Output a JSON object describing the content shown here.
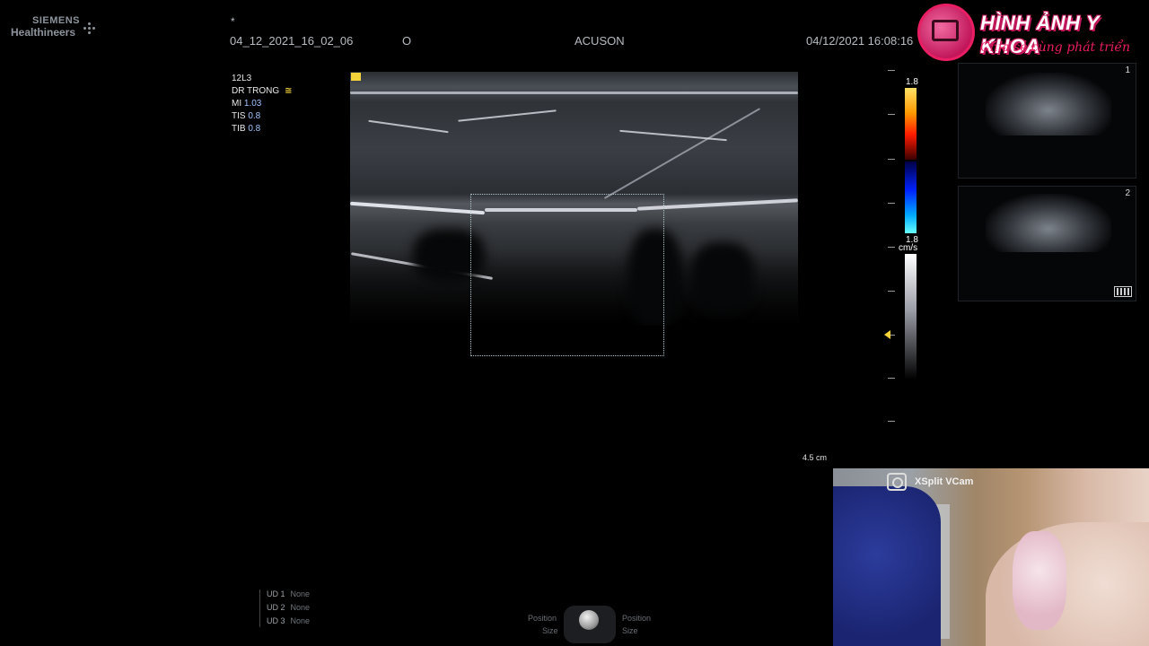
{
  "brand": {
    "line1": "SIEMENS",
    "line2": "Healthineers"
  },
  "header": {
    "star": "*",
    "study_id": "04_12_2021_16_02_06",
    "letter": "O",
    "system": "ACUSON",
    "datetime": "04/12/2021 16:08:16"
  },
  "logo": {
    "title": "HÌNH ẢNH Y KHOA",
    "subtitle": "Chia sẻ cùng phát triển"
  },
  "params": {
    "probe": "12L3",
    "doctor": "DR TRONG",
    "marker": "≅",
    "mi_label": "MI",
    "mi_value": "1.03",
    "tis_label": "TIS",
    "tis_value": "0.8",
    "tib_label": "TIB",
    "tib_value": "0.8"
  },
  "scale": {
    "depth": "4.5 cm"
  },
  "colorbar": {
    "top_value": "1.8",
    "bottom_value": "1.8",
    "unit": "cm/s"
  },
  "thumbnails": [
    {
      "number": "1"
    },
    {
      "number": "2"
    }
  ],
  "user_defined": [
    {
      "label": "UD 1",
      "value": "None"
    },
    {
      "label": "UD 2",
      "value": "None"
    },
    {
      "label": "UD 3",
      "value": "None"
    }
  ],
  "trackball": {
    "left_top": "Position",
    "left_bottom": "Size",
    "right_top": "Position",
    "right_bottom": "Size"
  },
  "webcam": {
    "label": "XSplit VCam"
  },
  "colors": {
    "accent_yellow": "#f3d23a",
    "logo_pink": "#e91e63",
    "param_value": "#9fc4ff"
  }
}
